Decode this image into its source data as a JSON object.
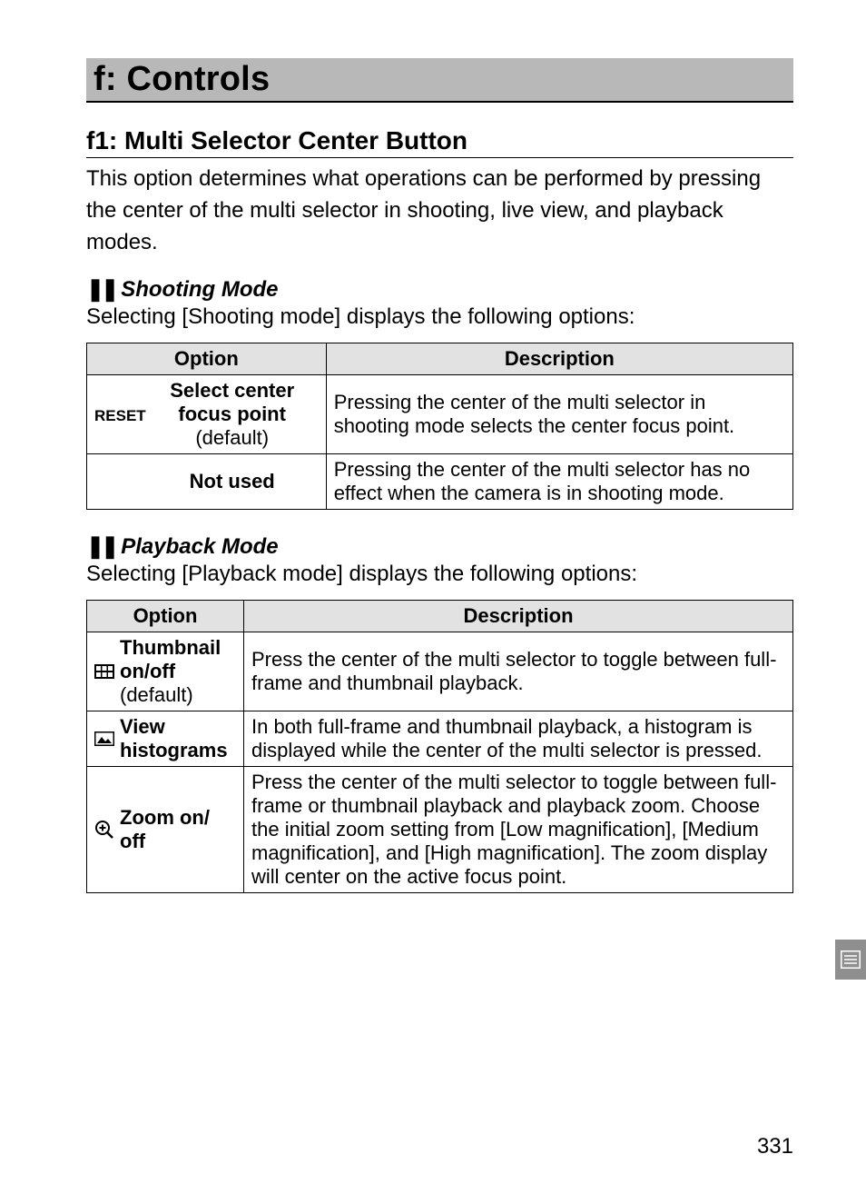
{
  "section_heading": "f: Controls",
  "subsection_heading": "f1: Multi Selector Center Button",
  "intro_text": "This option determines what operations can be performed by pressing the center of the multi selector in shooting, live view, and playback modes.",
  "shooting": {
    "mode_prefix": "❚❚",
    "mode_label": "Shooting Mode",
    "mode_intro": "Selecting [Shooting mode] displays the following options:",
    "headers": {
      "option": "Option",
      "description": "Description"
    },
    "rows": [
      {
        "icon_label": "RESET",
        "option_main": "Select center focus point",
        "option_default": "(default)",
        "description": "Pressing the center of the multi selector in shooting mode selects the center focus point."
      },
      {
        "icon_label": "",
        "option_main": "Not used",
        "option_default": "",
        "description": "Pressing the center of the multi selector has no effect when the camera is in shooting mode."
      }
    ]
  },
  "playback": {
    "mode_prefix": "❚❚",
    "mode_label": "Playback Mode",
    "mode_intro": "Selecting [Playback mode] displays the following options:",
    "headers": {
      "option": "Option",
      "description": "Description"
    },
    "rows": [
      {
        "icon_name": "thumbnail-grid-icon",
        "option_main": "Thumbnail on/off",
        "option_default": "(default)",
        "description": "Press the center of the multi selector to toggle between full-frame and thumbnail playback."
      },
      {
        "icon_name": "image-icon",
        "option_main": "View histograms",
        "option_default": "",
        "description": "In both full-frame and thumbnail playback, a histogram is displayed while the center of the multi selector is pressed."
      },
      {
        "icon_name": "zoom-in-icon",
        "option_main": "Zoom on/ off",
        "option_default": "",
        "description": "Press the center of the multi selector to toggle between full-frame or thumbnail playback and playback zoom.  Choose the initial zoom setting from [Low magnification], [Medium magnification], and [High magnification].  The zoom display will center on the active focus point."
      }
    ]
  },
  "page_number": "331"
}
